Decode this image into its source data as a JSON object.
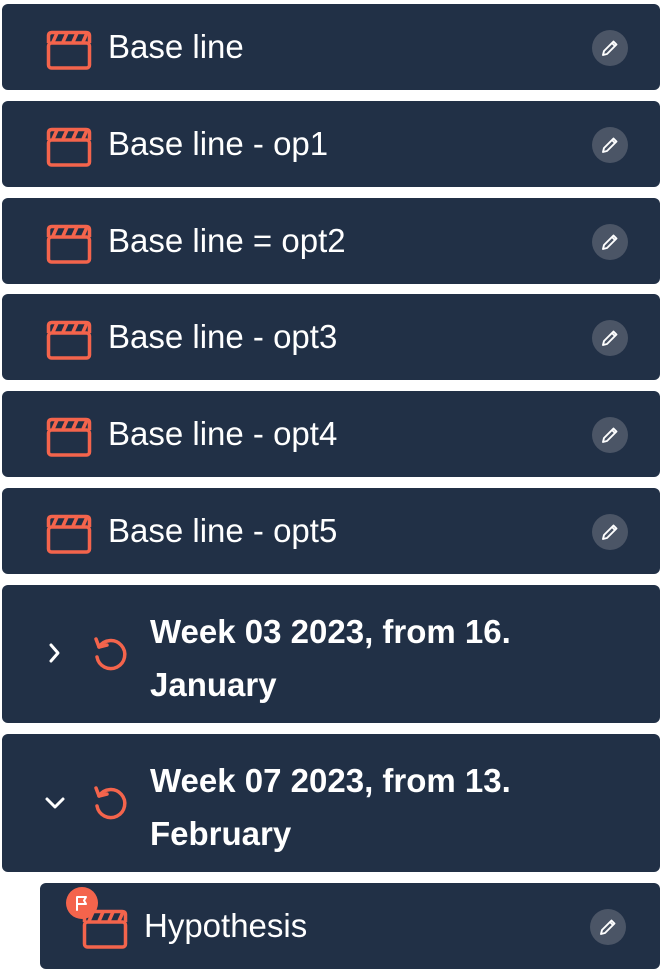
{
  "colors": {
    "card_bg": "#213046",
    "accent": "#f4644c",
    "edit_button_bg": "#4b5566",
    "text": "#ffffff"
  },
  "scenarios": [
    {
      "label": "Base line",
      "icon": "clapperboard-icon",
      "action_icon": "pencil-icon"
    },
    {
      "label": "Base line - op1",
      "icon": "clapperboard-icon",
      "action_icon": "pencil-icon"
    },
    {
      "label": "Base line = opt2",
      "icon": "clapperboard-icon",
      "action_icon": "pencil-icon"
    },
    {
      "label": "Base line - opt3",
      "icon": "clapperboard-icon",
      "action_icon": "pencil-icon"
    },
    {
      "label": "Base line - opt4",
      "icon": "clapperboard-icon",
      "action_icon": "pencil-icon"
    },
    {
      "label": "Base line - opt5",
      "icon": "clapperboard-icon",
      "action_icon": "pencil-icon"
    }
  ],
  "weeks": [
    {
      "title": "Week 03 2023, from 16. January",
      "expanded": false,
      "chevron_icon": "chevron-right-icon",
      "icon": "refresh-icon"
    },
    {
      "title": "Week 07 2023, from 13. February",
      "expanded": true,
      "chevron_icon": "chevron-down-icon",
      "icon": "refresh-icon",
      "children": [
        {
          "label": "Hypothesis",
          "icon": "clapperboard-icon",
          "badge_icon": "flag-icon",
          "action_icon": "pencil-icon"
        }
      ]
    }
  ]
}
